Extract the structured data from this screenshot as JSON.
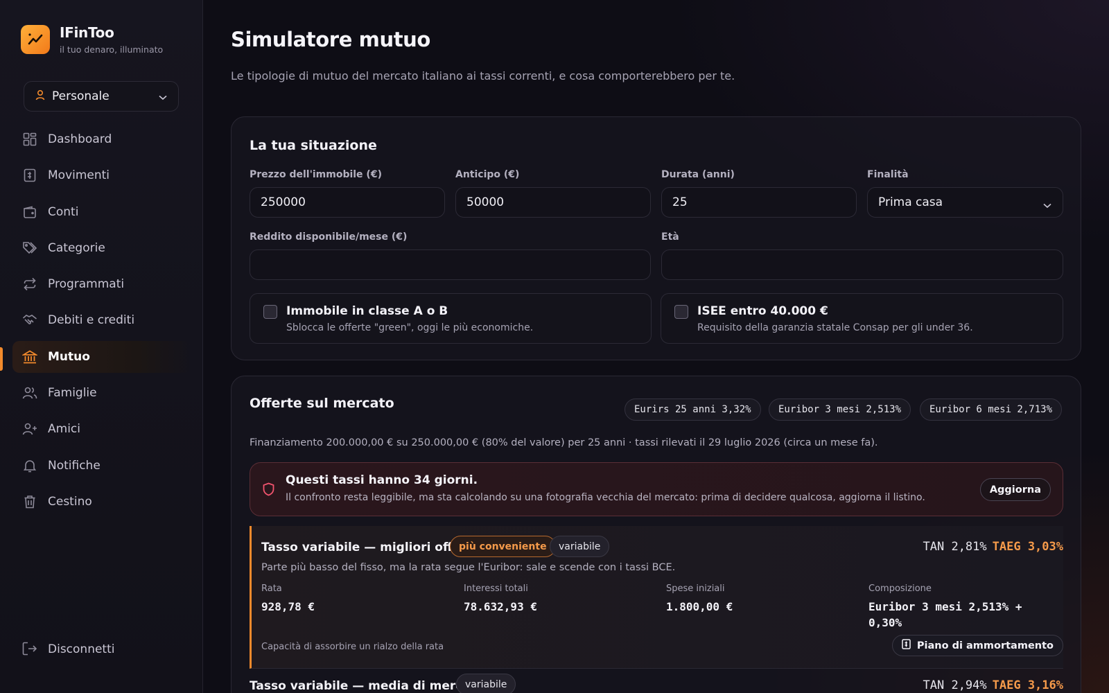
{
  "brand": {
    "name": "IFinToo",
    "tagline": "il tuo denaro, illuminato"
  },
  "profile": {
    "label": "Personale"
  },
  "nav": {
    "items": [
      {
        "label": "Dashboard",
        "icon": "dashboard-icon"
      },
      {
        "label": "Movimenti",
        "icon": "receipt-icon"
      },
      {
        "label": "Conti",
        "icon": "wallet-icon"
      },
      {
        "label": "Categorie",
        "icon": "tags-icon"
      },
      {
        "label": "Programmati",
        "icon": "repeat-icon"
      },
      {
        "label": "Debiti e crediti",
        "icon": "handshake-icon"
      },
      {
        "label": "Mutuo",
        "icon": "bank-icon",
        "active": true
      },
      {
        "label": "Famiglie",
        "icon": "users-icon"
      },
      {
        "label": "Amici",
        "icon": "user-plus-icon"
      },
      {
        "label": "Notifiche",
        "icon": "bell-icon"
      },
      {
        "label": "Cestino",
        "icon": "trash-icon"
      }
    ],
    "logout": "Disconnetti"
  },
  "page": {
    "title": "Simulatore mutuo",
    "subtitle": "Le tipologie di mutuo del mercato italiano ai tassi correnti, e cosa comporterebbero per te."
  },
  "situation": {
    "title": "La tua situazione",
    "price": {
      "label": "Prezzo dell'immobile (€)",
      "value": "250000"
    },
    "downpayment": {
      "label": "Anticipo (€)",
      "value": "50000"
    },
    "duration": {
      "label": "Durata (anni)",
      "value": "25"
    },
    "purpose": {
      "label": "Finalità",
      "value": "Prima casa"
    },
    "income": {
      "label": "Reddito disponibile/mese (€)",
      "value": ""
    },
    "age": {
      "label": "Età",
      "value": ""
    },
    "green": {
      "title": "Immobile in classe A o B",
      "desc": "Sblocca le offerte \"green\", oggi le più economiche.",
      "checked": false
    },
    "isee": {
      "title": "ISEE entro 40.000 €",
      "desc": "Requisito della garanzia statale Consap per gli under 36.",
      "checked": false
    }
  },
  "market": {
    "title": "Offerte sul mercato",
    "chips": [
      "Eurirs 25 anni 3,32%",
      "Euribor 3 mesi 2,513%",
      "Euribor 6 mesi 2,713%"
    ],
    "financing": "Finanziamento 200.000,00 € su 250.000,00 € (80% del valore) per 25 anni · tassi rilevati il 29 luglio 2026 (circa un mese fa).",
    "alert": {
      "title": "Questi tassi hanno 34 giorni.",
      "desc": "Il confronto resta leggibile, ma sta calcolando su una fotografia vecchia del mercato: prima di decidere qualcosa, aggiorna il listino.",
      "button": "Aggiorna"
    },
    "offers": [
      {
        "title": "Tasso variabile — migliori offerte",
        "badge_best": "più conveniente",
        "badge_type": "variabile",
        "tan": "TAN 2,81%",
        "taeg": "TAEG 3,03%",
        "desc": "Parte più basso del fisso, ma la rata segue l'Euribor: sale e scende con i tassi BCE.",
        "metrics": [
          {
            "label": "Rata",
            "value": "928,78 €"
          },
          {
            "label": "Interessi totali",
            "value": "78.632,93 €"
          },
          {
            "label": "Spese iniziali",
            "value": "1.800,00 €"
          },
          {
            "label": "Composizione",
            "value": "Euribor 3 mesi 2,513% + 0,30%"
          }
        ],
        "capacity": "Capacità di assorbire un rialzo della rata",
        "plan_button": "Piano di ammortamento"
      },
      {
        "title": "Tasso variabile — media di mercato",
        "badge_type": "variabile",
        "tan": "TAN 2,94%",
        "taeg": "TAEG 3,16%"
      }
    ]
  },
  "colors": {
    "accent": "#f28a2c",
    "background": "#0e0d15",
    "alert_border": "#5b2e36"
  }
}
